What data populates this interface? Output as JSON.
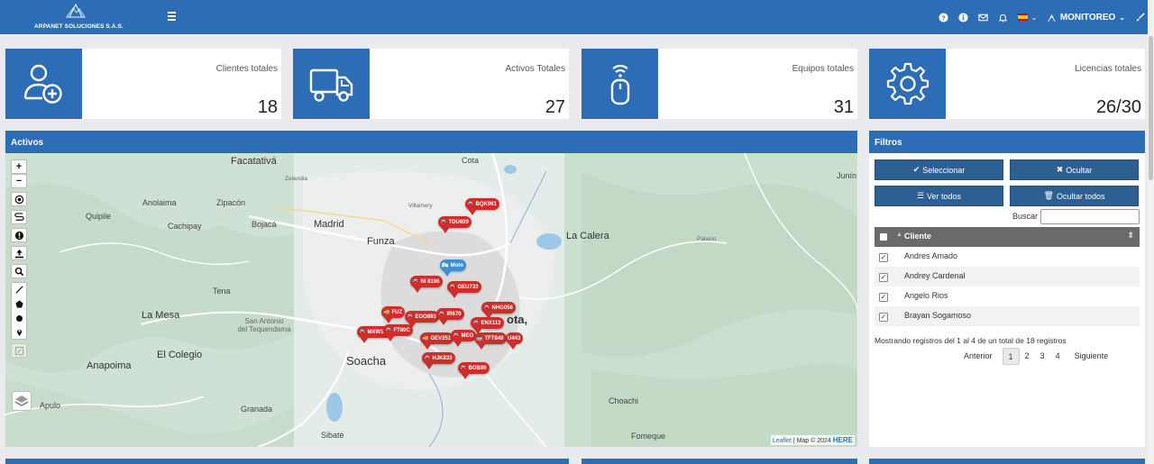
{
  "header": {
    "company": "ARPANET SOLUCIONES S.A.S.",
    "user": "MONITOREO",
    "icons": [
      "help-icon",
      "info-icon",
      "mail-icon",
      "bell-icon",
      "flag-es-icon",
      "user-icon",
      "brush-icon"
    ]
  },
  "stats": [
    {
      "label": "Clientes totales",
      "value": "18",
      "icon": "add-user-icon"
    },
    {
      "label": "Activos Totales",
      "value": "27",
      "icon": "truck-icon"
    },
    {
      "label": "Equipos totales",
      "value": "31",
      "icon": "gps-device-icon"
    },
    {
      "label": "Licencias totales",
      "value": "26/30",
      "icon": "gear-icon"
    }
  ],
  "panels": {
    "activos_title": "Activos",
    "filtros_title": "Filtros"
  },
  "map": {
    "places": {
      "facatativa": "Facatativá",
      "cota": "Cota",
      "junin": "Junín",
      "madrid": "Madrid",
      "funza": "Funza",
      "la_calera": "La Calera",
      "la_mesa": "La Mesa",
      "soacha": "Soacha",
      "el_colegio": "El Colegio",
      "anapoima": "Anapoima",
      "granada": "Granada",
      "sibate": "Sibaté",
      "fomeque": "Fomeque",
      "choachi": "Choachi",
      "anolaima": "Anolaima",
      "zipacon": "Zipacón",
      "quipile": "Quipile",
      "cachipay": "Cachipay",
      "bojaca": "Bojacá",
      "tena": "Tena",
      "apulo": "Apulo",
      "san_antonio": "San Antonio\ndel Tequendama",
      "palacio": "Palacio",
      "villamery": "Villamery",
      "zelandia": "Zelandia",
      "bogota": "ota,"
    },
    "attribution_leaflet": "Leaflet",
    "attribution_map": " | Map © 2024 ",
    "attribution_here": "HERE",
    "markers": [
      "BQK961",
      "TDU609",
      "Moto",
      "NI 8196",
      "GEU733",
      "NHG056",
      "FUZ",
      "EOO893",
      "IR670",
      "ENX113",
      "MXW195",
      "FT80C",
      "GEV251",
      "MEO",
      "TFT849",
      "U443",
      "HJK833",
      "BOB90"
    ]
  },
  "filters": {
    "select": "Seleccionar",
    "hide": "Ocultar",
    "show_all": "Ver todos",
    "hide_all": "Ocultar todos",
    "search_label": "Buscar",
    "search_value": "",
    "column": "Cliente",
    "rows": [
      "Andres Amado",
      "Andrey Cardenal",
      "Angelo Rios",
      "Brayan Sogamoso"
    ],
    "info": "Mostrando registros del 1 al 4 de un total de 18 registros",
    "prev": "Anterior",
    "pages": [
      "1",
      "2",
      "3",
      "4"
    ],
    "next": "Siguiente"
  },
  "colors": {
    "primary": "#2d6db5",
    "button": "#2d5f93",
    "marker": "#cc2f2b",
    "marker_blue": "#3b8fd4"
  }
}
